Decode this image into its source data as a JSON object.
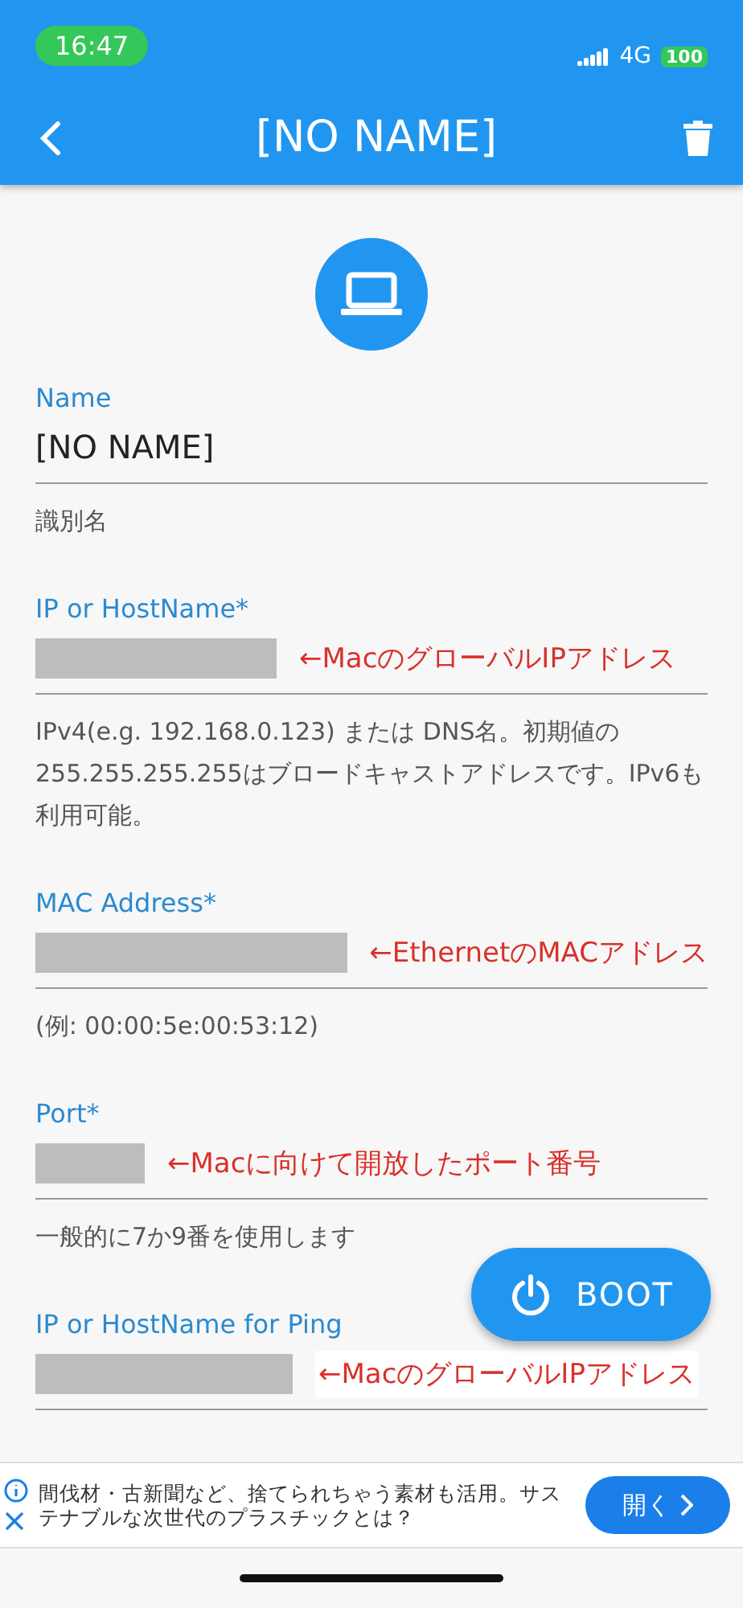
{
  "status_bar": {
    "time": "16:47",
    "network": "4G",
    "battery": "100"
  },
  "nav": {
    "title": "[NO NAME]"
  },
  "fields": [
    {
      "label": "Name",
      "input": {
        "kind": "text",
        "value": "[NO NAME]"
      },
      "helper": "識別名"
    },
    {
      "label": "IP or HostName*",
      "input": {
        "kind": "redacted"
      },
      "annotation": {
        "text": "←MacのグローバルIPアドレス",
        "boxed": false
      },
      "helper": "IPv4(e.g. 192.168.0.123) または DNS名。初期値の255.255.255.255はブロードキャストアドレスです。IPv6も利用可能。"
    },
    {
      "label": "MAC Address*",
      "input": {
        "kind": "redacted"
      },
      "annotation": {
        "text": "←EthernetのMACアドレス",
        "boxed": false
      },
      "helper": "(例: 00:00:5e:00:53:12)"
    },
    {
      "label": "Port*",
      "input": {
        "kind": "redacted"
      },
      "annotation": {
        "text": "←Macに向けて開放したポート番号",
        "boxed": false
      },
      "helper": "一般的に7か9番を使用します"
    },
    {
      "label": "IP or HostName for Ping",
      "input": {
        "kind": "redacted"
      },
      "annotation": {
        "text": "←MacのグローバルIPアドレス",
        "boxed": true
      }
    }
  ],
  "fab": {
    "label": "BOOT"
  },
  "ad": {
    "text": "間伐材・古新聞など、捨てられちゃう素材も活用。サステナブルな次世代のプラスチックとは？",
    "button": "開く"
  }
}
